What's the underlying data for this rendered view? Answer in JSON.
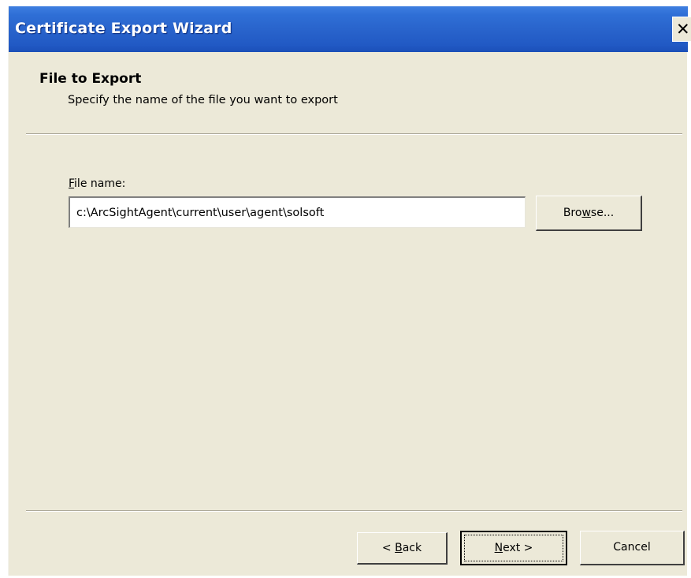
{
  "window": {
    "title": "Certificate Export Wizard",
    "close_glyph": "✕"
  },
  "header": {
    "title": "File to Export",
    "subtitle": "Specify the name of the file you want to export"
  },
  "form": {
    "file_label_mnemonic": "F",
    "file_label_rest": "ile name:",
    "file_value": "c:\\ArcSightAgent\\current\\user\\agent\\solsoft",
    "browse_pre": "Bro",
    "browse_mnemonic": "w",
    "browse_post": "se..."
  },
  "footer": {
    "back_pre": "< ",
    "back_mnemonic": "B",
    "back_post": "ack",
    "next_mnemonic": "N",
    "next_post": "ext >",
    "cancel_label": "Cancel"
  },
  "colors": {
    "titlebar": "#2964cc",
    "dialog_background": "#ece9d8",
    "title_text": "#ffffff"
  },
  "icons": {
    "close": "close-icon"
  }
}
